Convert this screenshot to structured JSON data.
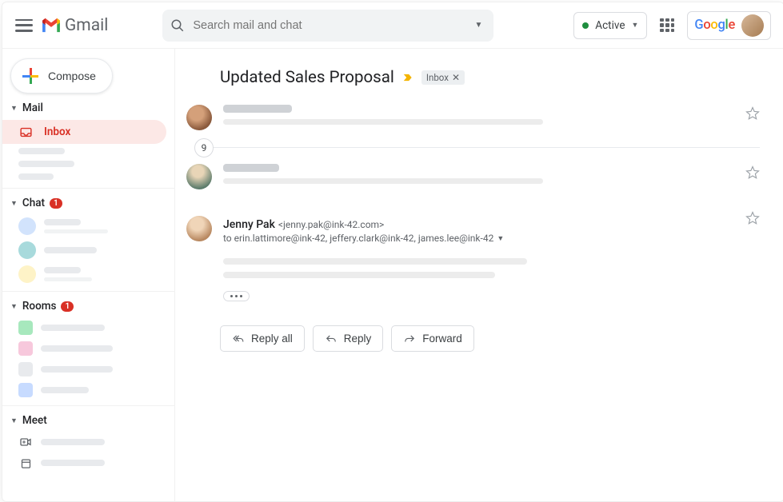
{
  "header": {
    "brand": "Gmail",
    "search_placeholder": "Search mail and chat",
    "status_label": "Active",
    "google_label": "Google"
  },
  "sidebar": {
    "compose_label": "Compose",
    "sections": {
      "mail": {
        "label": "Mail",
        "inbox_label": "Inbox"
      },
      "chat": {
        "label": "Chat",
        "badge": "1"
      },
      "rooms": {
        "label": "Rooms",
        "badge": "1"
      },
      "meet": {
        "label": "Meet"
      }
    }
  },
  "thread": {
    "subject": "Updated Sales Proposal",
    "label_chip": "Inbox",
    "collapsed_count": "9",
    "expanded": {
      "sender_name": "Jenny Pak",
      "sender_email": "<jenny.pak@ink-42.com>",
      "recipients": "to erin.lattimore@ink-42, jeffery.clark@ink-42, james.lee@ink-42"
    },
    "actions": {
      "reply_all": "Reply all",
      "reply": "Reply",
      "forward": "Forward"
    }
  }
}
